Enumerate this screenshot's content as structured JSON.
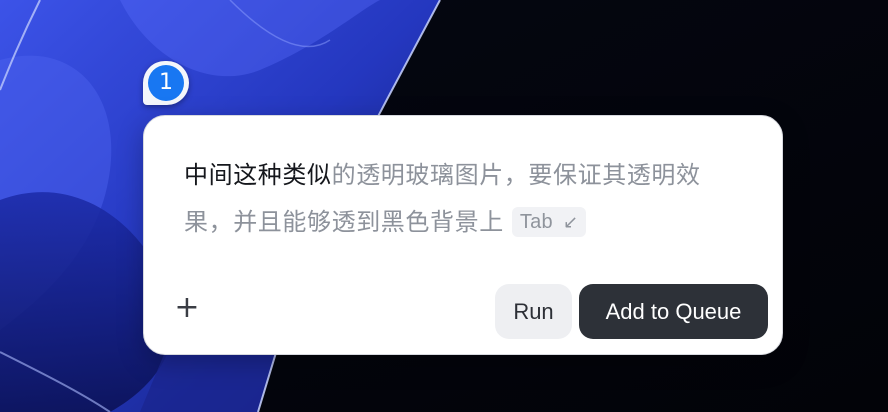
{
  "badge": {
    "number": "1"
  },
  "prompt": {
    "typed_text": "中间这种类似",
    "suggestion_text": "的透明玻璃图片，要保证其透明效果，并且能够透到黑色背景上",
    "tab_hint_label": "Tab",
    "tab_hint_icon": "arrow-down-left-icon"
  },
  "actions": {
    "add_icon": "plus-icon",
    "run_label": "Run",
    "queue_label": "Add to Queue"
  },
  "colors": {
    "accent_badge": "#1877f2",
    "primary_button": "#2d3138",
    "secondary_button": "#eeeff2",
    "wallpaper_blue": "#2b3fd0",
    "background": "#03040a"
  }
}
